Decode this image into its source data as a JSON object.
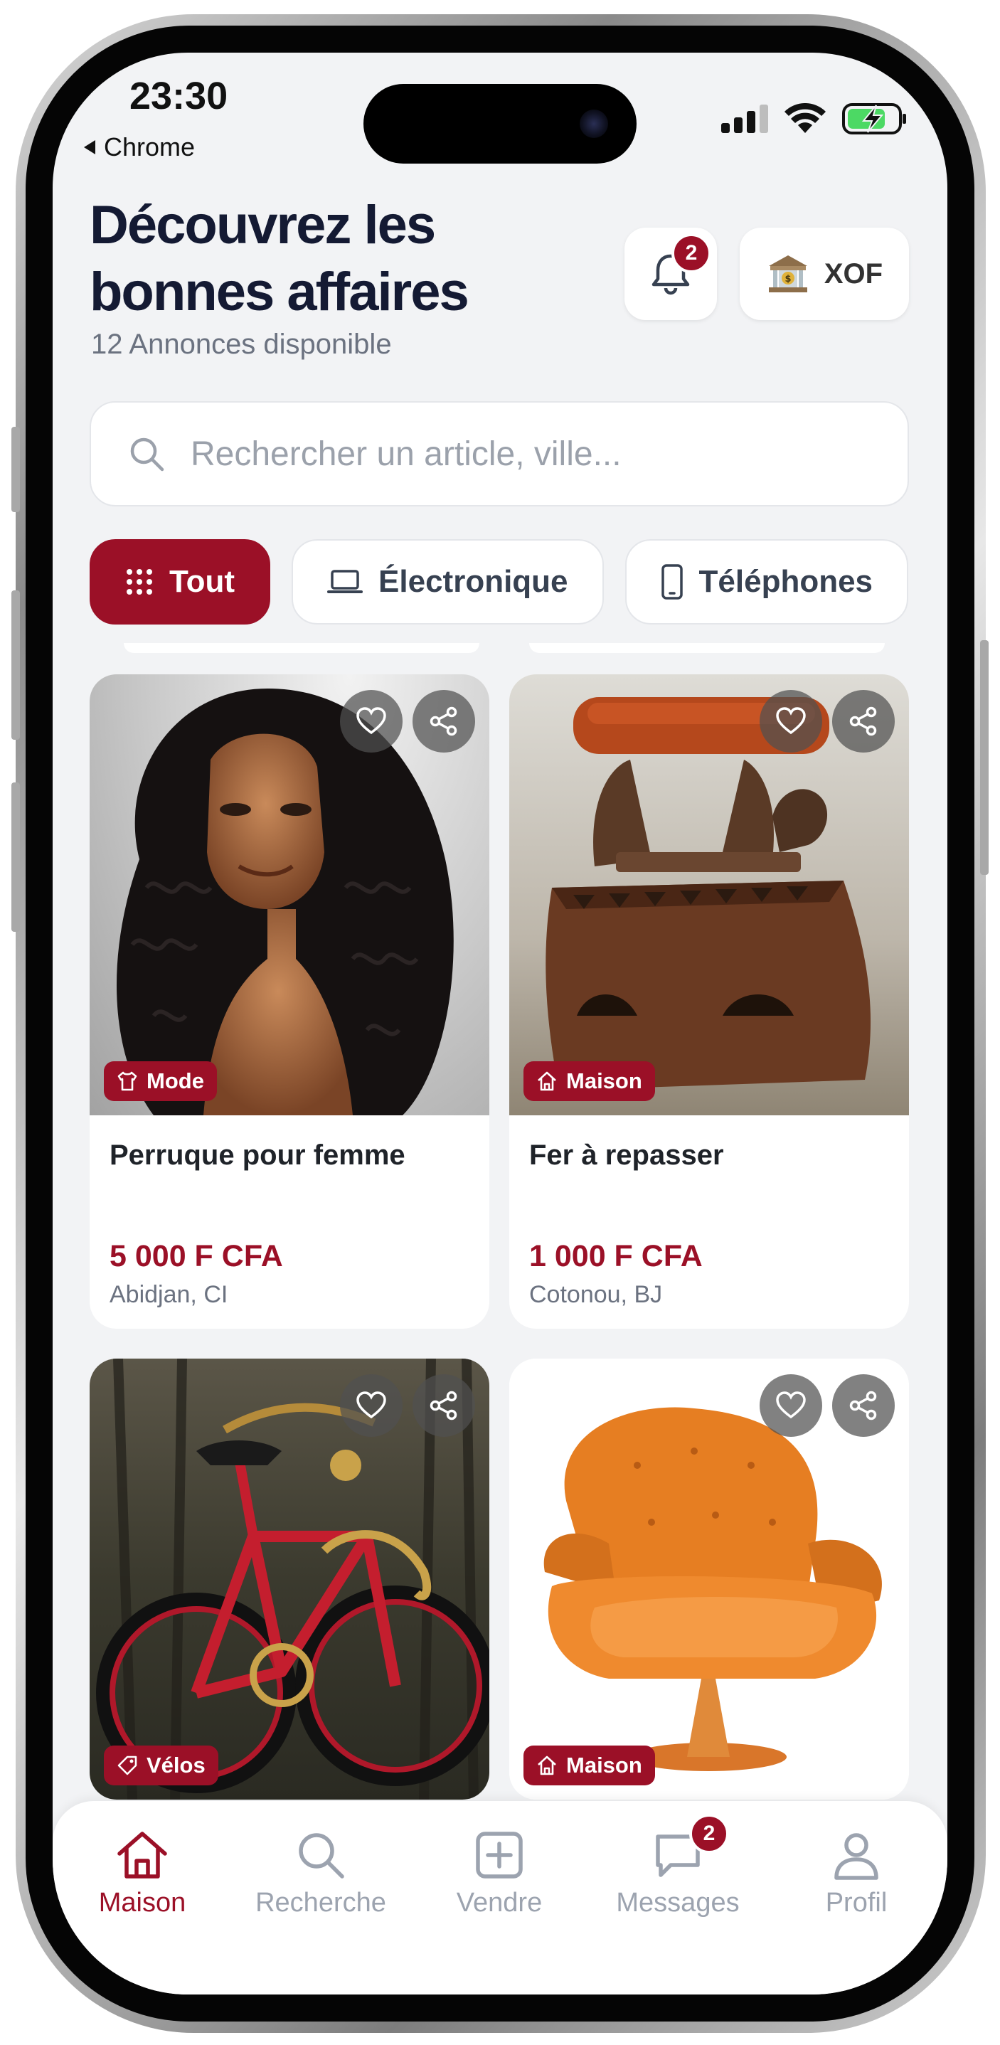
{
  "status_bar": {
    "time": "23:30",
    "back_app": "Chrome"
  },
  "header": {
    "title": "Découvrez les bonnes affaires",
    "subtitle": "12 Annonces disponible",
    "notification_count": "2",
    "currency": "XOF"
  },
  "search": {
    "placeholder": "Rechercher un article, ville..."
  },
  "categories": [
    {
      "label": "Tout",
      "icon": "grid-icon",
      "active": true
    },
    {
      "label": "Électronique",
      "icon": "laptop-icon",
      "active": false
    },
    {
      "label": "Téléphones",
      "icon": "phone-icon",
      "active": false
    }
  ],
  "listings": [
    {
      "category": "Mode",
      "category_icon": "shirt-icon",
      "title": "Perruque pour femme",
      "price": "5 000 F CFA",
      "location": "Abidjan, CI"
    },
    {
      "category": "Maison",
      "category_icon": "home-icon",
      "title": "Fer à repasser",
      "price": "1 000 F CFA",
      "location": "Cotonou, BJ"
    },
    {
      "category": "Vélos",
      "category_icon": "tag-icon",
      "title": "",
      "price": "",
      "location": ""
    },
    {
      "category": "Maison",
      "category_icon": "home-icon",
      "title": "",
      "price": "",
      "location": ""
    }
  ],
  "tabbar": {
    "items": [
      {
        "label": "Maison",
        "icon": "home-icon",
        "active": true
      },
      {
        "label": "Recherche",
        "icon": "search-icon",
        "active": false
      },
      {
        "label": "Vendre",
        "icon": "plus-square-icon",
        "active": false
      },
      {
        "label": "Messages",
        "icon": "chat-icon",
        "active": false,
        "badge": "2"
      },
      {
        "label": "Profil",
        "icon": "user-icon",
        "active": false
      }
    ]
  },
  "colors": {
    "accent": "#9b1027",
    "background": "#f2f3f5",
    "title": "#141a33"
  }
}
